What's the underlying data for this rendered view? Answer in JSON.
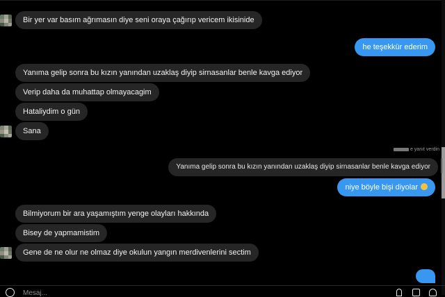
{
  "chat": {
    "messages": [
      {
        "direction": "incoming",
        "text": "Bir yer var basım ağrımasın diye seni oraya çağırıp vericem ikisinide"
      },
      {
        "direction": "outgoing",
        "text": "he teşekkür ederim"
      },
      {
        "direction": "incoming",
        "text": "Yanıma gelip sonra bu kızın yanından uzaklaş diyip sirnasanlar benle kavga ediyor"
      },
      {
        "direction": "incoming",
        "text": "Verip daha da muhattap olmayacagim"
      },
      {
        "direction": "incoming",
        "text": "Hataliydim o gün"
      },
      {
        "direction": "incoming",
        "text": "Sana"
      },
      {
        "direction": "outgoing",
        "text": "niye böyle bişi diyolar",
        "emoji": "smiling-face-emoji"
      },
      {
        "direction": "incoming",
        "text": "Bilmiyorum bir ara yaşamıştım yenge olayları hakkında"
      },
      {
        "direction": "incoming",
        "text": "Bisey de yapmamistim"
      },
      {
        "direction": "incoming",
        "text": "Gene de ne olur ne olmaz diye okulun yangın merdivenlerini sectim"
      }
    ],
    "reply": {
      "note": "e yanıt verdin",
      "quoted_text": "Yanıma gelip sonra bu kızın yanından uzaklaş diyip sirnasanlar benle kavga ediyor"
    }
  },
  "composer": {
    "placeholder": "Mesaj...",
    "icons": [
      "emoji-icon",
      "microphone-icon",
      "image-icon",
      "heart-icon"
    ]
  },
  "colors": {
    "background": "#000000",
    "incoming_bubble": "#262626",
    "outgoing_bubble": "#3897f0"
  }
}
